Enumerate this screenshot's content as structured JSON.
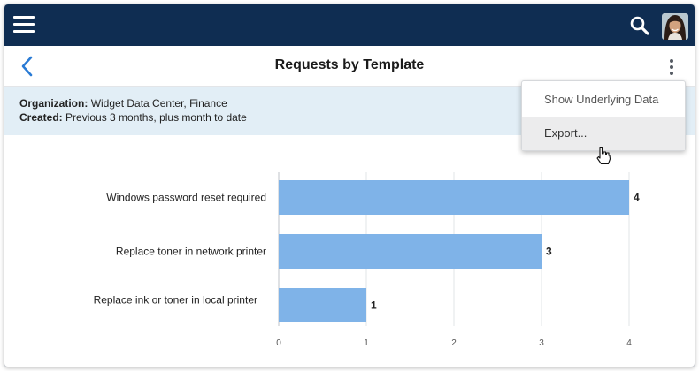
{
  "header": {
    "title": "Requests by Template"
  },
  "filters": {
    "org_label": "Organization:",
    "org_value": "Widget Data Center, Finance",
    "created_label": "Created:",
    "created_value": "Previous 3 months, plus month to date"
  },
  "menu": {
    "items": [
      {
        "label": "Show Underlying Data"
      },
      {
        "label": "Export..."
      }
    ]
  },
  "colors": {
    "topbar": "#0f2d52",
    "bar": "#7fb3e8",
    "filter_bg": "#e2eef6",
    "accent": "#2a7bd5"
  },
  "icons": [
    "menu-icon",
    "search-icon",
    "avatar",
    "back-icon",
    "kebab-icon",
    "pointer-cursor-icon"
  ],
  "chart_data": {
    "type": "bar",
    "orientation": "horizontal",
    "categories": [
      "Windows password reset required",
      "Replace toner in network printer",
      "Replace ink or toner in local printer"
    ],
    "values": [
      4,
      3,
      1
    ],
    "value_labels": [
      "4",
      "3",
      "1"
    ],
    "xlim": [
      0,
      4
    ],
    "xticks": [
      "0",
      "1",
      "2",
      "3",
      "4"
    ],
    "grid": true
  }
}
